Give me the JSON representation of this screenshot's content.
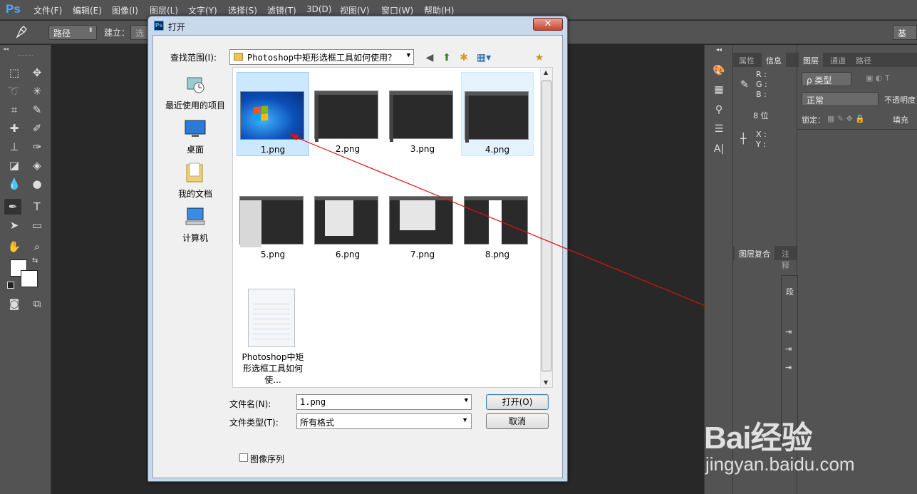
{
  "app": {
    "logo": "Ps"
  },
  "menu": [
    "文件(F)",
    "编辑(E)",
    "图像(I)",
    "图层(L)",
    "文字(Y)",
    "选择(S)",
    "滤镜(T)",
    "3D(D)",
    "视图(V)",
    "窗口(W)",
    "帮助(H)"
  ],
  "options": {
    "path_mode": "路径",
    "build_label": "建立：",
    "build_btn": "选",
    "workspace": "基本"
  },
  "panels": {
    "info_tabs": [
      "属性",
      "信息"
    ],
    "info": {
      "r": "R :",
      "g": "G :",
      "b": "B :",
      "bits": "8 位",
      "x": "X :",
      "y": "Y :"
    },
    "layer_tabs": [
      "图层",
      "通道",
      "路径"
    ],
    "layer_kind": "ρ 类型",
    "blend_mode": "正常",
    "opacity_label": "不透明度",
    "lock_label": "锁定：",
    "fill_label": "填充",
    "comp_tabs": [
      "图层复合",
      "注释"
    ],
    "para_label": "段"
  },
  "dialog": {
    "title": "打开",
    "look_in_label": "查找范围(I):",
    "look_in_value": "Photoshop中矩形选框工具如何使用？",
    "places": [
      "最近使用的项目",
      "桌面",
      "我的文档",
      "计算机"
    ],
    "files": [
      {
        "name": "1.png"
      },
      {
        "name": "2.png"
      },
      {
        "name": "3.png"
      },
      {
        "name": "4.png"
      },
      {
        "name": "5.png"
      },
      {
        "name": "6.png"
      },
      {
        "name": "7.png"
      },
      {
        "name": "8.png"
      },
      {
        "name": "Photoshop中矩形选框工具如何使..."
      }
    ],
    "filename_label": "文件名(N):",
    "filename_value": "1.png",
    "filetype_label": "文件类型(T):",
    "filetype_value": "所有格式",
    "open_btn": "打开(O)",
    "cancel_btn": "取消",
    "sequence_label": "图像序列"
  },
  "watermark": {
    "brand": "Bai经验",
    "url": "jingyan.baidu.com"
  },
  "colors": {
    "ps_blue": "#4fa8ff",
    "annotation_arrow": "#e01010",
    "selection": "#cce8ff"
  }
}
